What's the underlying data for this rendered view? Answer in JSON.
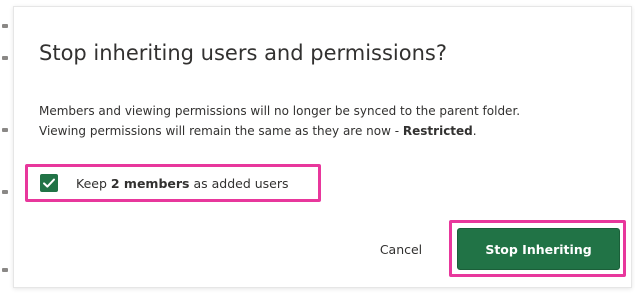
{
  "dialog": {
    "title": "Stop inheriting users and permissions?",
    "body_line1": "Members and viewing permissions will no longer be synced to the parent folder.",
    "body_line2_prefix": "Viewing permissions will remain the same as they are now - ",
    "body_line2_bold": "Restricted",
    "body_line2_suffix": "."
  },
  "checkbox": {
    "checked": true,
    "label_prefix": "Keep ",
    "label_bold": "2 members",
    "label_suffix": " as added users"
  },
  "buttons": {
    "cancel_label": "Cancel",
    "primary_label": "Stop Inheriting"
  },
  "colors": {
    "accent": "#217346",
    "highlight": "#e8379c",
    "text": "#323130"
  },
  "icons": {
    "checkbox": "checkmark-icon"
  }
}
